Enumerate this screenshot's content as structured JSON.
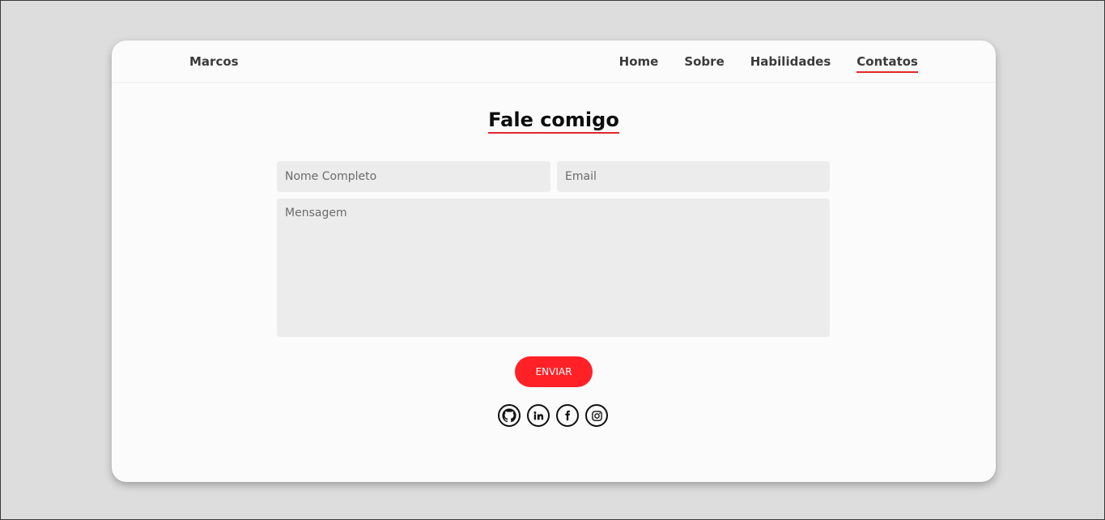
{
  "nav": {
    "brand": "Marcos",
    "links": [
      {
        "label": "Home"
      },
      {
        "label": "Sobre"
      },
      {
        "label": "Habilidades"
      },
      {
        "label": "Contatos",
        "active": true
      }
    ]
  },
  "contact": {
    "title": "Fale comigo",
    "name_placeholder": "Nome Completo",
    "email_placeholder": "Email",
    "message_placeholder": "Mensagem",
    "submit_label": "ENVIAR",
    "social": [
      "github-icon",
      "linkedin-icon",
      "facebook-icon",
      "instagram-icon"
    ]
  },
  "colors": {
    "accent": "#ff2126",
    "underline": "#e0282c",
    "background": "#dcdddc",
    "card": "#fbfbfb",
    "field": "#ececec"
  }
}
